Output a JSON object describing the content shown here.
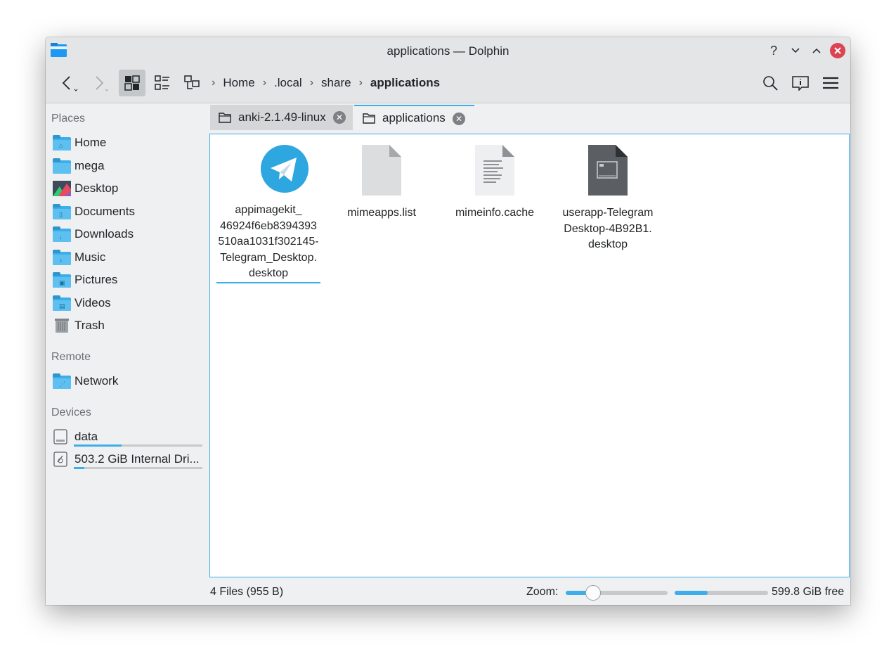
{
  "window": {
    "title": "applications — Dolphin",
    "help_label": "?",
    "minimize_label": "⌄",
    "maximize_label": "⌃",
    "close_label": "✕"
  },
  "breadcrumb": {
    "arrow": "›",
    "items": [
      "Home",
      ".local",
      "share",
      "applications"
    ]
  },
  "sidebar": {
    "places_heading": "Places",
    "places": [
      {
        "label": "Home",
        "icon": "home-folder-icon"
      },
      {
        "label": "mega",
        "icon": "folder-icon"
      },
      {
        "label": "Desktop",
        "icon": "desktop-icon"
      },
      {
        "label": "Documents",
        "icon": "documents-folder-icon"
      },
      {
        "label": "Downloads",
        "icon": "downloads-folder-icon"
      },
      {
        "label": "Music",
        "icon": "music-folder-icon"
      },
      {
        "label": "Pictures",
        "icon": "pictures-folder-icon"
      },
      {
        "label": "Videos",
        "icon": "videos-folder-icon"
      },
      {
        "label": "Trash",
        "icon": "trash-icon"
      }
    ],
    "remote_heading": "Remote",
    "remote": [
      {
        "label": "Network",
        "icon": "network-folder-icon"
      }
    ],
    "devices_heading": "Devices",
    "devices": [
      {
        "label": "data",
        "usage": 0.37
      },
      {
        "label": "503.2 GiB Internal Dri...",
        "usage": 0.08
      }
    ]
  },
  "tabs": [
    {
      "label": "anki-2.1.49-linux",
      "active": false
    },
    {
      "label": "applications",
      "active": true
    }
  ],
  "files": [
    {
      "name_lines": [
        "appimagekit_",
        "46924f6eb8394393",
        "510aa1031f302145-",
        "Telegram_Desktop.",
        "desktop"
      ],
      "icon": "telegram-icon",
      "selected": true
    },
    {
      "name_lines": [
        "mimeapps.list"
      ],
      "icon": "blank-file-icon",
      "selected": false
    },
    {
      "name_lines": [
        "mimeinfo.cache"
      ],
      "icon": "text-file-icon",
      "selected": false
    },
    {
      "name_lines": [
        "userapp-Telegram",
        "Desktop-4B92B1.",
        "desktop"
      ],
      "icon": "executable-file-icon",
      "selected": false
    }
  ],
  "status": {
    "summary": "4 Files (955 B)",
    "zoom_label": "Zoom:",
    "zoom_level": 0.27,
    "free_space": "599.8 GiB free",
    "disk_used": 0.35
  },
  "colors": {
    "accent": "#3daee9",
    "close_button": "#da4453",
    "telegram_blue": "#2ea6e0"
  }
}
